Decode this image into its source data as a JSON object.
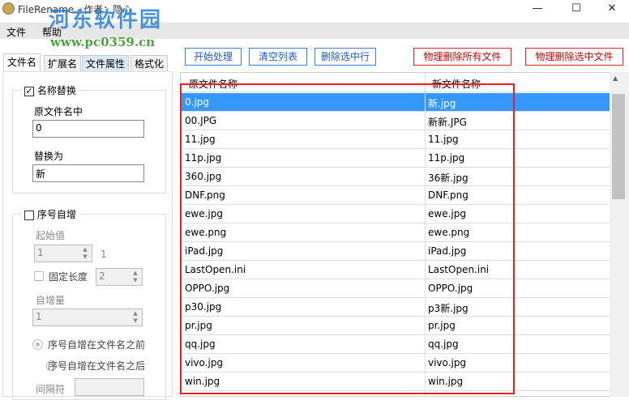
{
  "window": {
    "title": "FileRename - 作者：隐心",
    "minimize": "—",
    "maximize": "☐",
    "close": "✕"
  },
  "watermark": {
    "text": "河东软件园",
    "url": "www.pc0359.cn"
  },
  "menu": [
    "文件",
    "帮助"
  ],
  "tabs": [
    "文件名",
    "扩展名",
    "文件属性",
    "格式化"
  ],
  "left": {
    "name_replace": {
      "label": "名称替换",
      "checked": true,
      "original_label": "原文件名中",
      "original_value": "0",
      "replace_label": "替换为",
      "replace_value": "新"
    },
    "seq": {
      "label": "序号自增",
      "checked": false,
      "start_label": "起始值",
      "start_value": "1",
      "start_preview": "1",
      "fixed_length_label": "固定长度",
      "fixed_length_value": "2",
      "increment_label": "自增量",
      "increment_value": "1",
      "before_label": "序号自增在文件名之前",
      "after_label": "序号自增在文件名之后",
      "separator_label": "间隔符",
      "separator_value": ""
    }
  },
  "toolbar": {
    "start": "开始处理",
    "clear": "清空列表",
    "delete_row": "删除选中行",
    "phys_delete_all": "物理删除所有文件",
    "phys_delete_selected": "物理删除选中文件"
  },
  "list": {
    "headers": [
      "原文件名称",
      "新文件名称"
    ],
    "rows": [
      [
        "0.jpg",
        "新.jpg"
      ],
      [
        "00.JPG",
        "新新.JPG"
      ],
      [
        "11.jpg",
        "11.jpg"
      ],
      [
        "11p.jpg",
        "11p.jpg"
      ],
      [
        "360.jpg",
        "36新.jpg"
      ],
      [
        "DNF.png",
        "DNF.png"
      ],
      [
        "ewe.jpg",
        "ewe.jpg"
      ],
      [
        "ewe.png",
        "ewe.png"
      ],
      [
        "iPad.jpg",
        "iPad.jpg"
      ],
      [
        "LastOpen.ini",
        "LastOpen.ini"
      ],
      [
        "OPPO.jpg",
        "OPPO.jpg"
      ],
      [
        "p30.jpg",
        "p3新.jpg"
      ],
      [
        "pr.jpg",
        "pr.jpg"
      ],
      [
        "qq.jpg",
        "qq.jpg"
      ],
      [
        "vivo.jpg",
        "vivo.jpg"
      ],
      [
        "win.jpg",
        "win.jpg"
      ]
    ],
    "selected_index": 0
  },
  "colors": {
    "accent": "#3399ff",
    "highlight": "#e62020"
  }
}
